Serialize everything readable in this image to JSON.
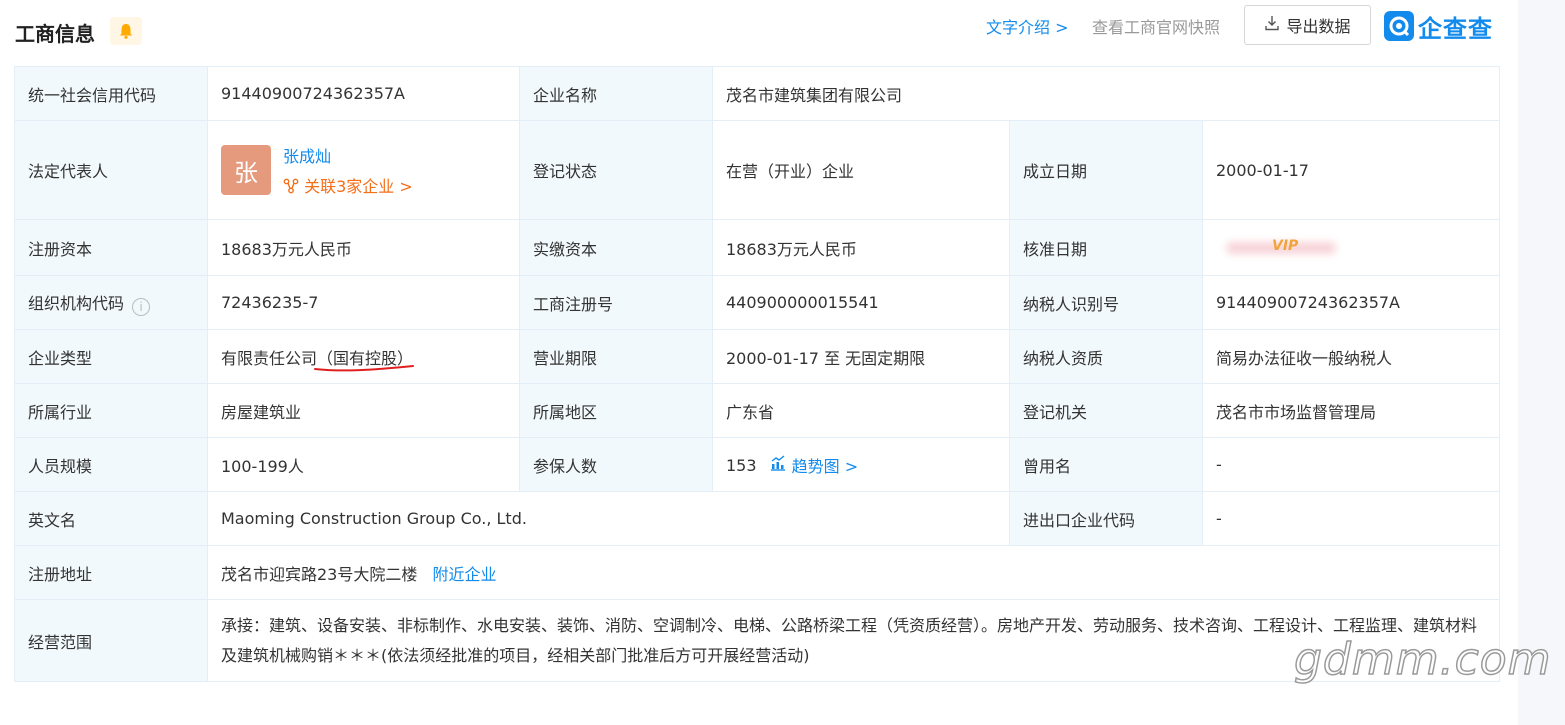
{
  "header": {
    "title": "工商信息",
    "intro_link": "文字介绍 >",
    "snapshot_link": "查看工商官网快照",
    "export_label": "导出数据",
    "brand_name": "企查查"
  },
  "rows": {
    "credit_code": {
      "label": "统一社会信用代码",
      "value": "91440900724362357A"
    },
    "company_name": {
      "label": "企业名称",
      "value": "茂名市建筑集团有限公司"
    },
    "legal_rep": {
      "label": "法定代表人",
      "avatar_char": "张",
      "name": "张成灿",
      "related": "关联3家企业 >"
    },
    "reg_status": {
      "label": "登记状态",
      "value": "在营（开业）企业"
    },
    "found_date": {
      "label": "成立日期",
      "value": "2000-01-17"
    },
    "reg_capital": {
      "label": "注册资本",
      "value": "18683万元人民币"
    },
    "paid_capital": {
      "label": "实缴资本",
      "value": "18683万元人民币"
    },
    "approval_date": {
      "label": "核准日期",
      "vip_badge": "VIP"
    },
    "org_code": {
      "label": "组织机构代码",
      "value": "72436235-7",
      "info_icon": "i"
    },
    "biz_reg_no": {
      "label": "工商注册号",
      "value": "440900000015541"
    },
    "taxpayer_id": {
      "label": "纳税人识别号",
      "value": "91440900724362357A"
    },
    "company_type": {
      "label": "企业类型",
      "value_prefix": "有限责任公司",
      "value_underlined": "（国有控股）"
    },
    "biz_term": {
      "label": "营业期限",
      "value": "2000-01-17 至 无固定期限"
    },
    "taxpayer_qual": {
      "label": "纳税人资质",
      "value": "简易办法征收一般纳税人"
    },
    "industry": {
      "label": "所属行业",
      "value": "房屋建筑业"
    },
    "region": {
      "label": "所属地区",
      "value": "广东省"
    },
    "reg_authority": {
      "label": "登记机关",
      "value": "茂名市市场监督管理局"
    },
    "staff_size": {
      "label": "人员规模",
      "value": "100-199人"
    },
    "insured": {
      "label": "参保人数",
      "value": "153",
      "trend_link": "趋势图 >"
    },
    "former_name": {
      "label": "曾用名",
      "value": "-"
    },
    "english_name": {
      "label": "英文名",
      "value": "Maoming Construction Group Co., Ltd."
    },
    "import_export_code": {
      "label": "进出口企业代码",
      "value": "-"
    },
    "address": {
      "label": "注册地址",
      "value": "茂名市迎宾路23号大院二楼",
      "nearby_link": "附近企业"
    },
    "scope": {
      "label": "经营范围",
      "value": "承接：建筑、设备安装、非标制作、水电安装、装饰、消防、空调制冷、电梯、公路桥梁工程（凭资质经营）。房地产开发、劳动服务、技术咨询、工程设计、工程监理、建筑材料及建筑机械购销＊＊＊(依法须经批准的项目，经相关部门批准后方可开展经营活动)"
    }
  },
  "watermark": "gdmm.com",
  "colors": {
    "link_blue": "#128bed",
    "orange": "#f56e18",
    "key_bg": "#f2f9fc",
    "border": "#e4eef6"
  }
}
